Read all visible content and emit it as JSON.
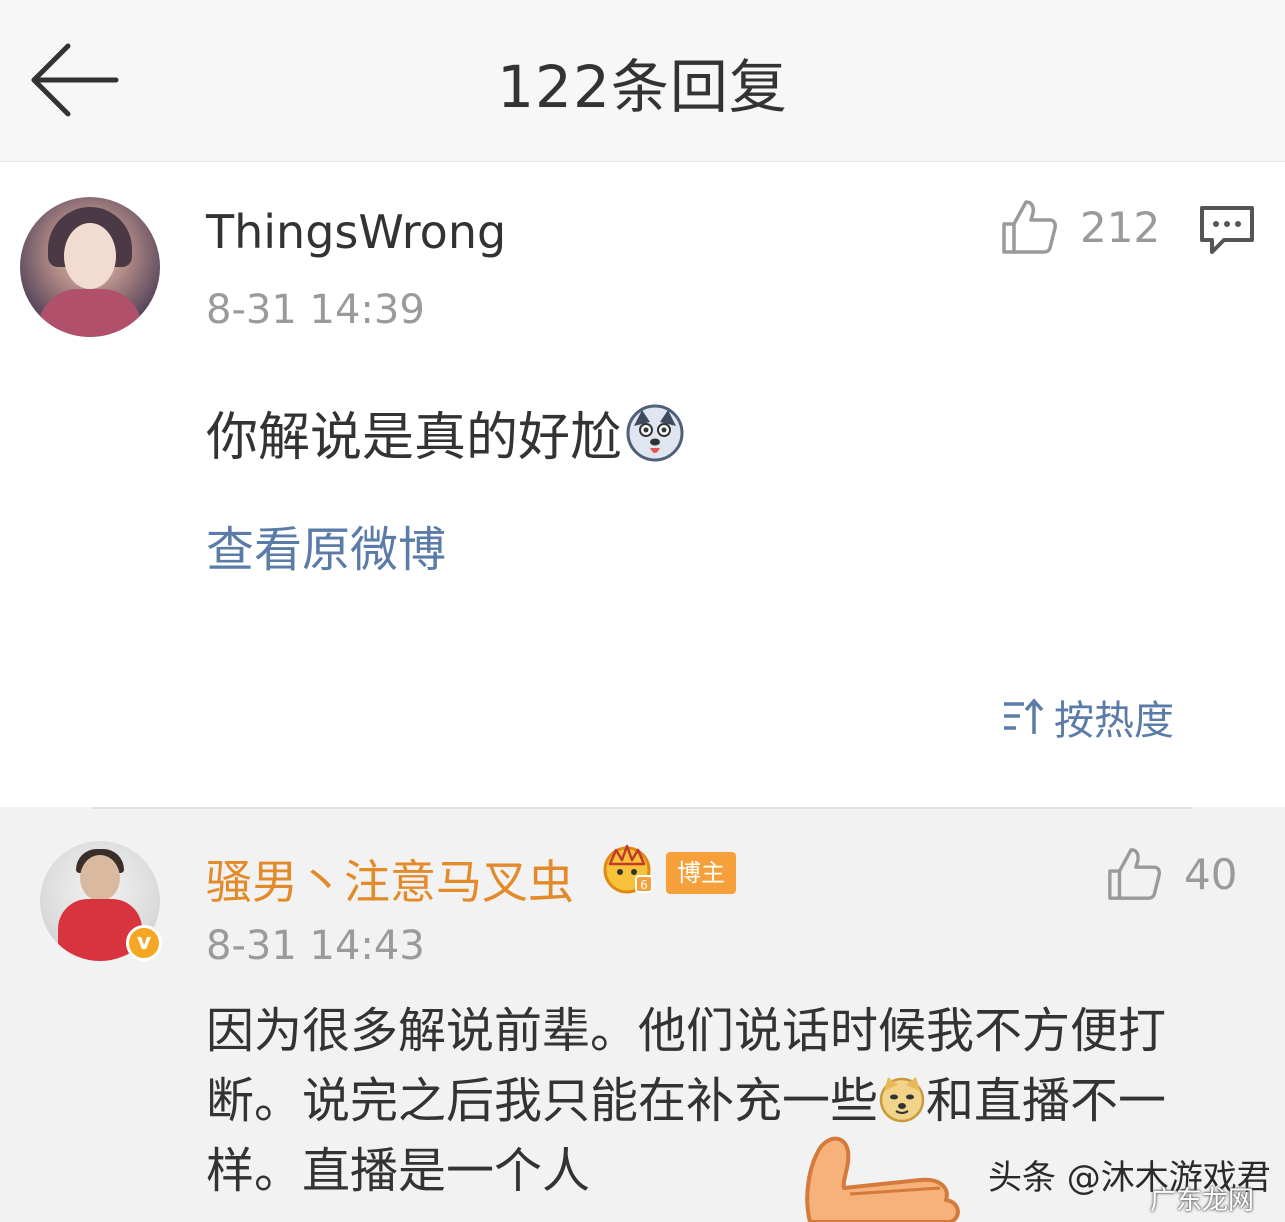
{
  "header": {
    "title": "122条回复"
  },
  "root_comment": {
    "username": "ThingsWrong",
    "timestamp": "8-31 14:39",
    "likes": "212",
    "text": "你解说是真的好尬",
    "emoji": "husky-emoji",
    "view_original_label": "查看原微博"
  },
  "sort": {
    "label": "按热度"
  },
  "replies": [
    {
      "username": "骚男丶注意马叉虫",
      "badge": "博主",
      "verified_mark": "v",
      "timestamp": "8-31 14:43",
      "likes": "40",
      "text_part1": "因为很多解说前辈。他们说话时候我不方便打断。说完之后我只能在补充一些",
      "text_part2": "和直播不一样。直播是一个人",
      "emoji": "doge-emoji"
    }
  ],
  "watermark": {
    "main": "头条 @沐木游戏君",
    "corner": "广东龙网"
  },
  "colors": {
    "link": "#5b7ba8",
    "vip_name": "#e38a2a",
    "badge": "#f5a03a",
    "muted": "#9a9a9a"
  }
}
